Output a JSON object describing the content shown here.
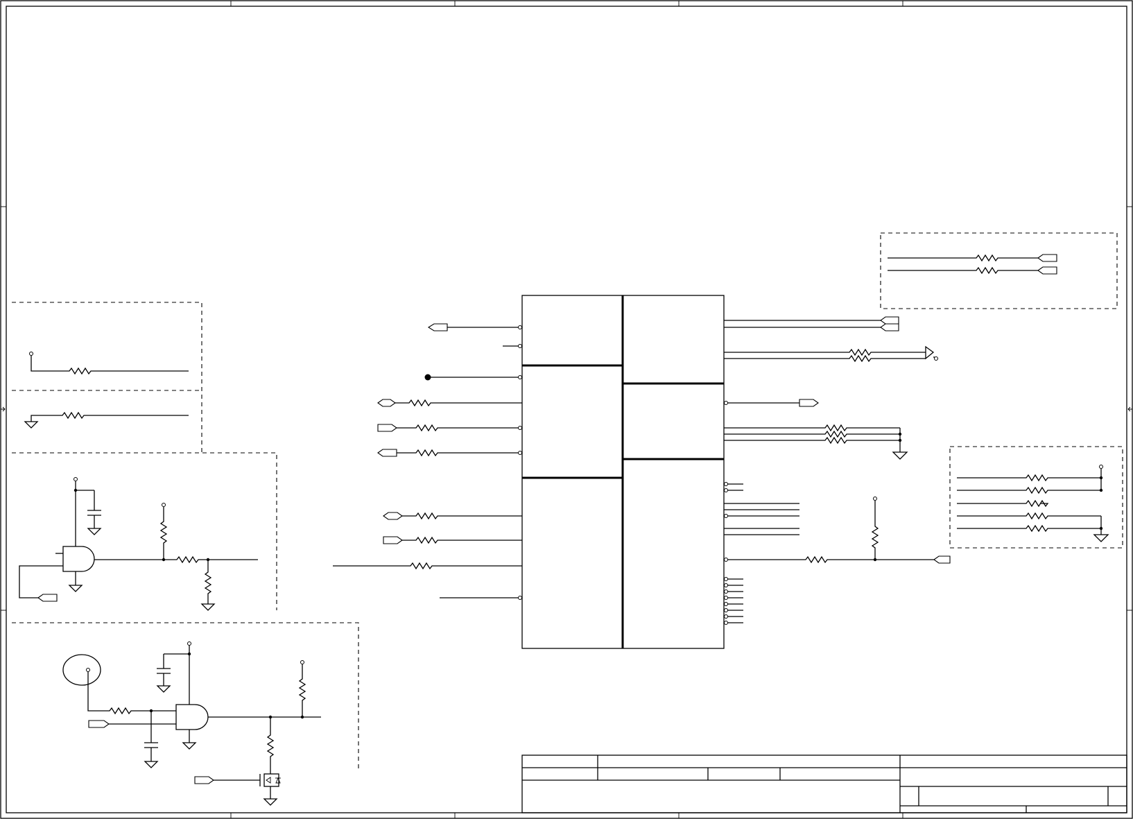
{
  "diagram": {
    "type": "electrical schematic",
    "colors": {
      "line": "#000000",
      "background": "#ffffff"
    },
    "title_block": {
      "cells": [
        "",
        "",
        "",
        "",
        "",
        "",
        "",
        "",
        "",
        ""
      ]
    }
  }
}
